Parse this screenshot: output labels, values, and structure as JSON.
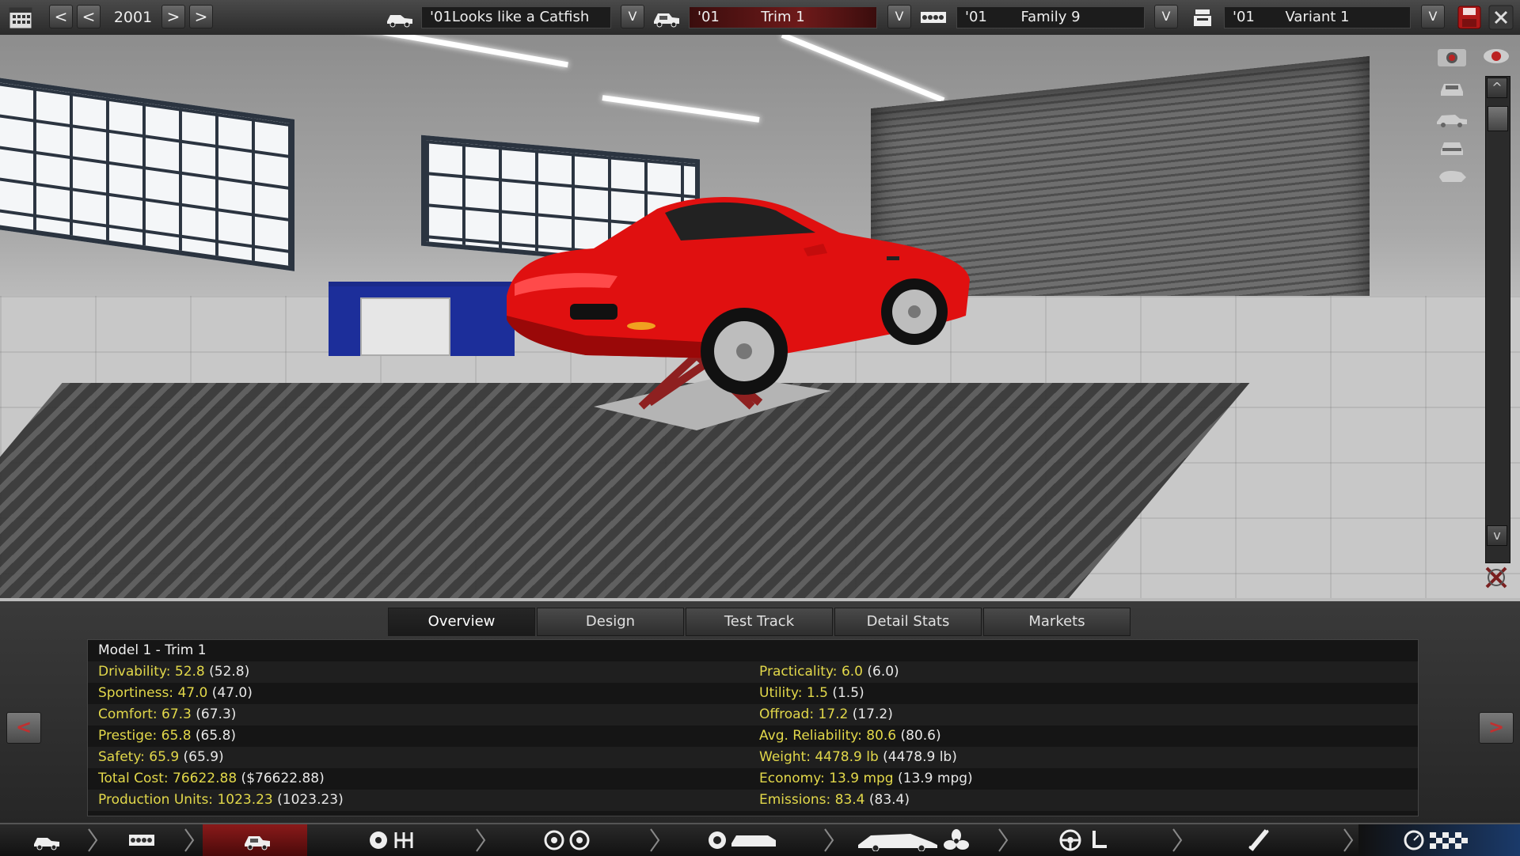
{
  "topbar": {
    "year": "2001",
    "model": {
      "year_prefix": "'01",
      "name": "'01Looks like a Catfish"
    },
    "trim": {
      "year_prefix": "'01",
      "name": "Trim 1"
    },
    "family": {
      "year_prefix": "'01",
      "name": "Family 9"
    },
    "variant": {
      "year_prefix": "'01",
      "name": "Variant 1"
    },
    "prev_label": "<",
    "next_label": ">",
    "dropdown_label": "V"
  },
  "viewport": {
    "scroll_up_label": "^",
    "scroll_down_label": "v"
  },
  "tabs": [
    {
      "label": "Overview",
      "active": true
    },
    {
      "label": "Design",
      "active": false
    },
    {
      "label": "Test Track",
      "active": false
    },
    {
      "label": "Detail Stats",
      "active": false
    },
    {
      "label": "Markets",
      "active": false
    }
  ],
  "stats": {
    "title": "Model 1 - Trim 1",
    "left": [
      {
        "label": "Drivability: ",
        "value": "52.8",
        "paren": " (52.8)"
      },
      {
        "label": "Sportiness: ",
        "value": "47.0",
        "paren": " (47.0)"
      },
      {
        "label": "Comfort: ",
        "value": "67.3",
        "paren": " (67.3)"
      },
      {
        "label": "Prestige: ",
        "value": "65.8",
        "paren": " (65.8)"
      },
      {
        "label": "Safety: ",
        "value": "65.9",
        "paren": " (65.9)"
      },
      {
        "label": "Total Cost: ",
        "value": "76622.88",
        "paren": " ($76622.88)"
      },
      {
        "label": "Production Units: ",
        "value": "1023.23",
        "paren": " (1023.23)"
      }
    ],
    "right": [
      {
        "label": "Practicality: ",
        "value": "6.0",
        "paren": " (6.0)"
      },
      {
        "label": "Utility: ",
        "value": "1.5",
        "paren": " (1.5)"
      },
      {
        "label": "Offroad: ",
        "value": "17.2",
        "paren": " (17.2)"
      },
      {
        "label": "Avg. Reliability: ",
        "value": "80.6",
        "paren": " (80.6)"
      },
      {
        "label": "Weight: ",
        "value": "4478.9 lb",
        "paren": " (4478.9 lb)"
      },
      {
        "label": "Economy: ",
        "value": "13.9 mpg",
        "paren": " (13.9 mpg)"
      },
      {
        "label": "Emissions: ",
        "value": "83.4",
        "paren": " (83.4)"
      }
    ],
    "prev_label": "<",
    "next_label": ">"
  },
  "colors": {
    "stat_label": "#e2d84a",
    "car_body": "#e01010",
    "active_nav": "#8a1a1a"
  },
  "bottomnav": {
    "items": [
      "car-model-icon",
      "engine-family-icon",
      "trim-body-icon",
      "chassis-gearbox-icon",
      "suspension-wheels-icon",
      "engine-block-icon",
      "aero-fan-icon",
      "interior-steering-icon",
      "fuel-system-icon",
      "test-track-icon"
    ],
    "active_index": 2
  }
}
